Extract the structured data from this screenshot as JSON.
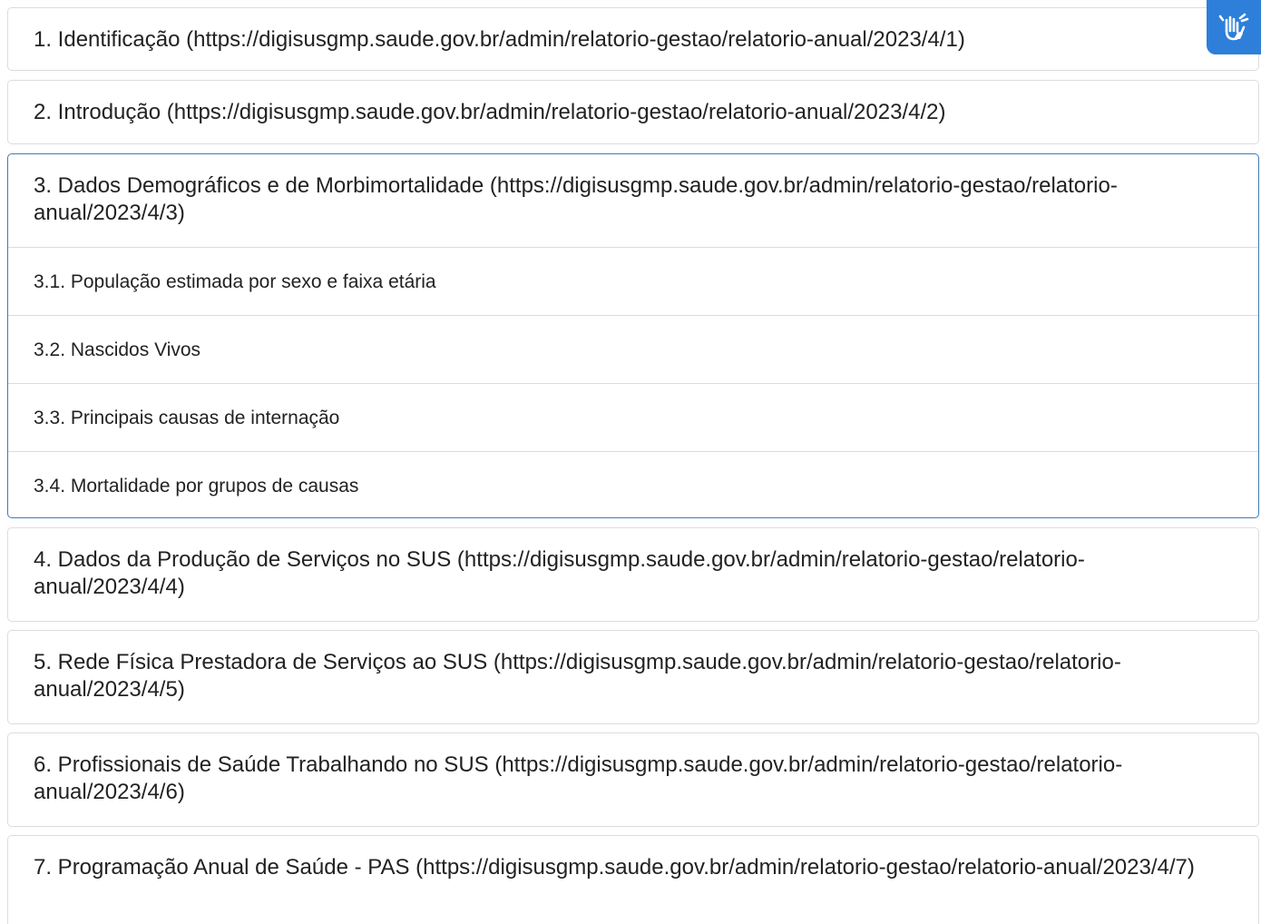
{
  "sections": [
    {
      "label": "1. Identificação (https://digisusgmp.saude.gov.br/admin/relatorio-gestao/relatorio-anual/2023/4/1)"
    },
    {
      "label": "2. Introdução (https://digisusgmp.saude.gov.br/admin/relatorio-gestao/relatorio-anual/2023/4/2)"
    },
    {
      "label": "3. Dados Demográficos e de Morbimortalidade (https://digisusgmp.saude.gov.br/admin/relatorio-gestao/relatorio-anual/2023/4/3)",
      "items": [
        "3.1. População estimada por sexo e faixa etária",
        "3.2. Nascidos Vivos",
        "3.3. Principais causas de internação",
        "3.4. Mortalidade por grupos de causas"
      ]
    },
    {
      "label": "4. Dados da Produção de Serviços no SUS (https://digisusgmp.saude.gov.br/admin/relatorio-gestao/relatorio-anual/2023/4/4)"
    },
    {
      "label": "5. Rede Física Prestadora de Serviços ao SUS (https://digisusgmp.saude.gov.br/admin/relatorio-gestao/relatorio-anual/2023/4/5)"
    },
    {
      "label": "6. Profissionais de Saúde Trabalhando no SUS (https://digisusgmp.saude.gov.br/admin/relatorio-gestao/relatorio-anual/2023/4/6)"
    },
    {
      "label": "7. Programação Anual de Saúde - PAS (https://digisusgmp.saude.gov.br/admin/relatorio-gestao/relatorio-anual/2023/4/7)"
    }
  ],
  "accessibility": {
    "icon": "sign-language-hand-icon",
    "color": "#2d7fd9"
  }
}
